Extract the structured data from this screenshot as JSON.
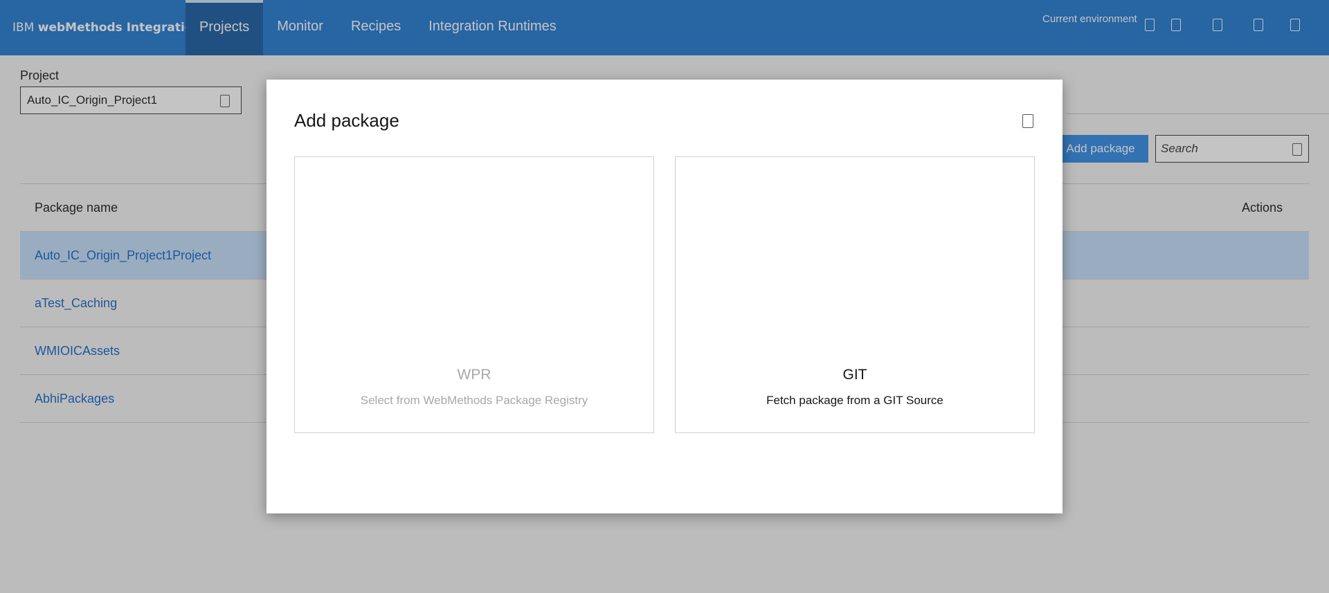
{
  "header": {
    "brand_prefix": "IBM",
    "brand_product": "webMethods Integration",
    "tabs": [
      {
        "label": "Projects",
        "active": true
      },
      {
        "label": "Monitor",
        "active": false
      },
      {
        "label": "Recipes",
        "active": false
      },
      {
        "label": "Integration Runtimes",
        "active": false
      }
    ],
    "environment_label": "Current environment",
    "icons": [
      "environment-icon",
      "notifications-icon",
      "help-icon",
      "settings-icon",
      "user-icon"
    ],
    "color": "#1f77d0"
  },
  "project": {
    "label": "Project",
    "selected": "Auto_IC_Origin_Project1"
  },
  "toolbar": {
    "add_package_label": "Add package",
    "search_placeholder": "Search"
  },
  "table": {
    "columns": [
      "Package name",
      "Actions"
    ],
    "rows": [
      {
        "name": "Auto_IC_Origin_Project1Project",
        "selected": true
      },
      {
        "name": "aTest_Caching",
        "selected": false
      },
      {
        "name": "WMIOICAssets",
        "selected": false
      },
      {
        "name": "AbhiPackages",
        "selected": false
      }
    ]
  },
  "modal": {
    "title": "Add package",
    "options": [
      {
        "title": "WPR",
        "description": "Select from WebMethods Package Registry",
        "enabled": false
      },
      {
        "title": "GIT",
        "description": "Fetch package from a GIT Source",
        "enabled": true
      }
    ]
  }
}
